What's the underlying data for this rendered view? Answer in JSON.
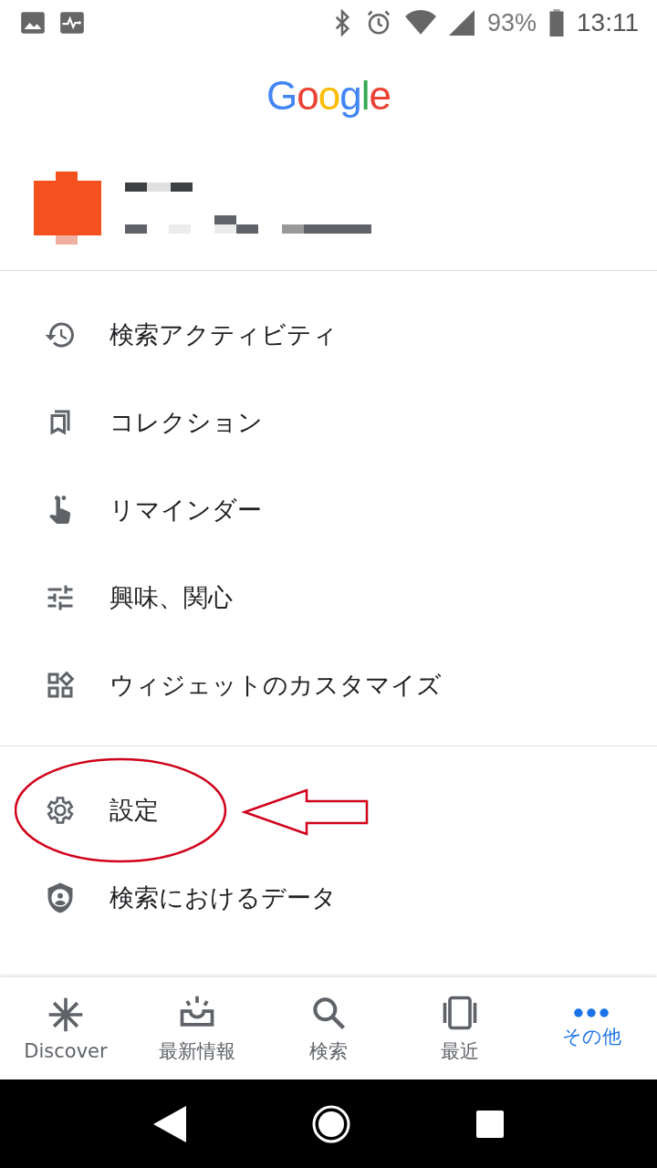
{
  "status_bar": {
    "battery": "93%",
    "time": "13:11"
  },
  "logo": "Google",
  "menu_groups": [
    {
      "items": [
        {
          "label": "検索アクティビティ",
          "highlighted": false
        },
        {
          "label": "コレクション",
          "highlighted": false
        },
        {
          "label": "リマインダー",
          "highlighted": false
        },
        {
          "label": "興味、関心",
          "highlighted": false
        },
        {
          "label": "ウィジェットのカスタマイズ",
          "highlighted": false
        }
      ]
    },
    {
      "items": [
        {
          "label": "設定",
          "highlighted": true
        },
        {
          "label": "検索におけるデータ",
          "highlighted": false
        }
      ]
    }
  ],
  "bottom_nav": [
    {
      "label": "Discover",
      "selected": false
    },
    {
      "label": "最新情報",
      "selected": false
    },
    {
      "label": "検索",
      "selected": false
    },
    {
      "label": "最近",
      "selected": false
    },
    {
      "label": "その他",
      "selected": true
    }
  ]
}
